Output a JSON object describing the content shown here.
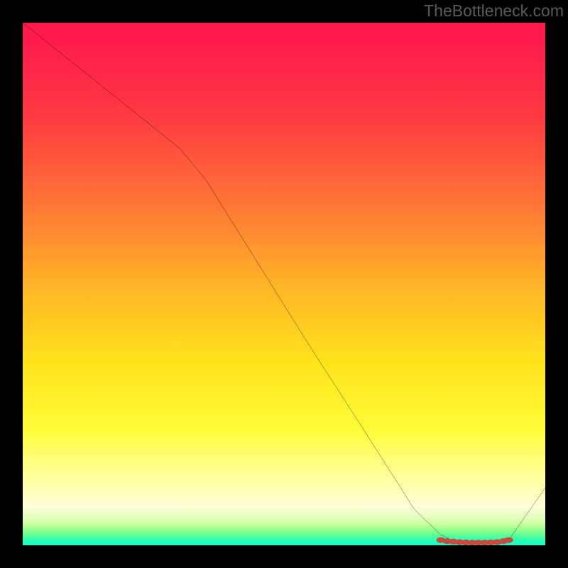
{
  "watermark": "TheBottleneck.com",
  "chart_data": {
    "type": "line",
    "title": "",
    "xlabel": "",
    "ylabel": "",
    "xlim": [
      0,
      100
    ],
    "ylim": [
      0,
      100
    ],
    "series": [
      {
        "name": "curve",
        "x": [
          0,
          10,
          20,
          30,
          35,
          45,
          55,
          65,
          75,
          80,
          83,
          85,
          88,
          91,
          93,
          100
        ],
        "y": [
          100,
          92,
          84,
          76,
          70,
          54,
          38,
          22.5,
          6.8,
          2.0,
          0.6,
          0.4,
          0.4,
          0.5,
          1.0,
          11
        ]
      }
    ],
    "markers": {
      "name": "highlight-band",
      "color": "#c94a3f",
      "x": [
        80,
        81.2,
        82.4,
        83.6,
        84.8,
        86,
        87.2,
        88.4,
        89.6,
        90.8,
        92,
        93
      ],
      "y": [
        1.0,
        0.8,
        0.7,
        0.6,
        0.55,
        0.5,
        0.5,
        0.5,
        0.55,
        0.6,
        0.8,
        1.0
      ]
    },
    "gradient_stops": [
      {
        "pos": 0,
        "color": "#ff1a4d"
      },
      {
        "pos": 0.36,
        "color": "#ff7a35"
      },
      {
        "pos": 0.65,
        "color": "#ffe31a"
      },
      {
        "pos": 0.87,
        "color": "#ffff9d"
      },
      {
        "pos": 0.96,
        "color": "#c8ff9f"
      },
      {
        "pos": 1.0,
        "color": "#12ffcc"
      }
    ]
  }
}
